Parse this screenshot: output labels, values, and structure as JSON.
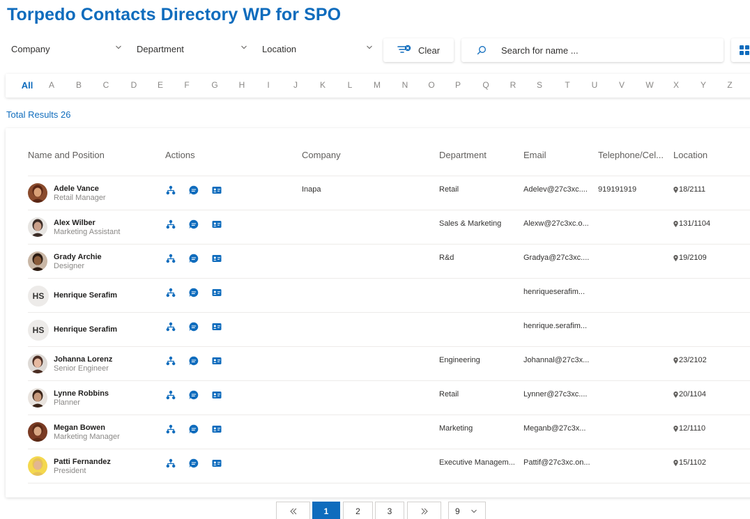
{
  "title": "Torpedo Contacts Directory WP for SPO",
  "filters": {
    "company": "Company",
    "department": "Department",
    "location": "Location",
    "clear_label": "Clear",
    "search_placeholder": "Search for name ..."
  },
  "alphabet": [
    "All",
    "A",
    "B",
    "C",
    "D",
    "E",
    "F",
    "G",
    "H",
    "I",
    "J",
    "K",
    "L",
    "M",
    "N",
    "O",
    "P",
    "Q",
    "R",
    "S",
    "T",
    "U",
    "V",
    "W",
    "X",
    "Y",
    "Z"
  ],
  "total_results": "Total Results 26",
  "table": {
    "headers": {
      "name": "Name and Position",
      "actions": "Actions",
      "company": "Company",
      "department": "Department",
      "email": "Email",
      "phone": "Telephone/Cel...",
      "location": "Location"
    },
    "rows": [
      {
        "name": "Adele Vance",
        "position": "Retail Manager",
        "company": "Inapa",
        "department": "Retail",
        "email": "Adelev@27c3xc....",
        "phone": "919191919",
        "location": "18/2111"
      },
      {
        "name": "Alex Wilber",
        "position": "Marketing Assistant",
        "company": "",
        "department": "Sales & Marketing",
        "email": "Alexw@27c3xc.o...",
        "phone": "",
        "location": "131/1104"
      },
      {
        "name": "Grady Archie",
        "position": "Designer",
        "company": "",
        "department": "R&d",
        "email": "Gradya@27c3xc....",
        "phone": "",
        "location": "19/2109"
      },
      {
        "name": "Henrique Serafim",
        "position": "",
        "initials": "HS",
        "company": "",
        "department": "",
        "email": "henriqueserafim...",
        "phone": "",
        "location": ""
      },
      {
        "name": "Henrique Serafim",
        "position": "",
        "initials": "HS",
        "company": "",
        "department": "",
        "email": "henrique.serafim...",
        "phone": "",
        "location": ""
      },
      {
        "name": "Johanna Lorenz",
        "position": "Senior Engineer",
        "company": "",
        "department": "Engineering",
        "email": "Johannal@27c3x...",
        "phone": "",
        "location": "23/2102"
      },
      {
        "name": "Lynne Robbins",
        "position": "Planner",
        "company": "",
        "department": "Retail",
        "email": "Lynner@27c3xc....",
        "phone": "",
        "location": "20/1104"
      },
      {
        "name": "Megan Bowen",
        "position": "Marketing Manager",
        "company": "",
        "department": "Marketing",
        "email": "Meganb@27c3x...",
        "phone": "",
        "location": "12/1110"
      },
      {
        "name": "Patti Fernandez",
        "position": "President",
        "company": "",
        "department": "Executive Managem...",
        "email": "Pattif@27c3xc.on...",
        "phone": "",
        "location": "15/1102"
      }
    ]
  },
  "pagination": {
    "first": "«",
    "pages": [
      "1",
      "2",
      "3"
    ],
    "last": "»",
    "page_size": "9"
  },
  "colors": {
    "accent": "#0f6cbd"
  }
}
